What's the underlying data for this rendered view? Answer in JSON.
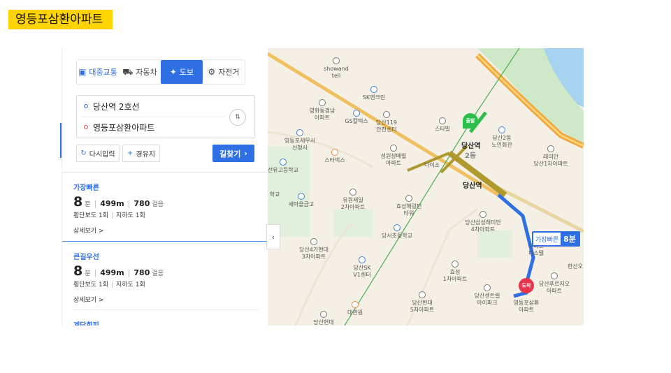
{
  "page_title": "영등포삼환아파트",
  "tabs": [
    {
      "label": "대중교통",
      "icon": "bus-icon"
    },
    {
      "label": "자동차",
      "icon": "car-icon"
    },
    {
      "label": "도보",
      "icon": "walk-icon",
      "active": true
    },
    {
      "label": "자전거",
      "icon": "bike-icon"
    }
  ],
  "close_icon": "×",
  "route": {
    "origin": "당산역 2호선",
    "destination": "영등포삼환아파트",
    "swap_icon": "⇅"
  },
  "buttons": {
    "reset": "다시입력",
    "via": "경유지",
    "search": "길찾기"
  },
  "options": [
    {
      "label": "가장빠른",
      "time": "8",
      "time_unit": "분",
      "distance": "499m",
      "steps": "780",
      "steps_unit": "걸음",
      "crosswalk": "횡단보도 1회",
      "underpass": "지하도 1회",
      "detail": "상세보기 >"
    },
    {
      "label": "큰길우선",
      "time": "8",
      "time_unit": "분",
      "distance": "499m",
      "steps": "780",
      "steps_unit": "걸음",
      "crosswalk": "횡단보도 1회",
      "underpass": "지하도 1회",
      "detail": "상세보기 >"
    },
    {
      "label": "계단회피"
    }
  ],
  "map": {
    "labels": {
      "showand": "showand\ntell",
      "sk_clinic": "SK엔크린",
      "yanghwa": "영화동경남\n아파트",
      "gs": "GS칼텍스",
      "dangsan119": "당산119\n안전센터",
      "starville": "스타빌",
      "dangsan2dong": "당산2동\n노인회관",
      "tax": "영등포세무서\n신청사",
      "sungwon": "성원상떼빌\n아파트",
      "daiso": "다이소",
      "starbucks": "스타벅스",
      "raemian": "래미안\n당산1차아파트",
      "highschool": "선유고등학교",
      "yuwon": "유원제일\n2차아파트",
      "hyoseong": "효성해링턴\n타워",
      "saemaeul": "새마을금고",
      "school": "학교",
      "dangsan_sam": "당산삼성래미안\n4차아파트",
      "elem": "당서초등학교",
      "dangsan4": "당산4가현대\n3차아파트",
      "sk_v1": "당산SK\nV1센터",
      "hyoseong1": "효성\n1차아파트",
      "central": "당산센트럴\n아이파크",
      "dangsan_h5": "당산현대\n5차아파트",
      "daegwan": "대관원",
      "dangsan_h": "당산현대",
      "samhwan": "영등포삼환\n아파트",
      "ssangyong": "당산푸르지오\n아파트",
      "hansam": "한산오",
      "mart": "이마트\n피스텔"
    },
    "station_top": "당산역",
    "station_main": "당산역",
    "station_sub": "2동",
    "start_pin": "출발",
    "end_pin": "도착",
    "badge_label": "가장빠른",
    "badge_time": "8분"
  }
}
